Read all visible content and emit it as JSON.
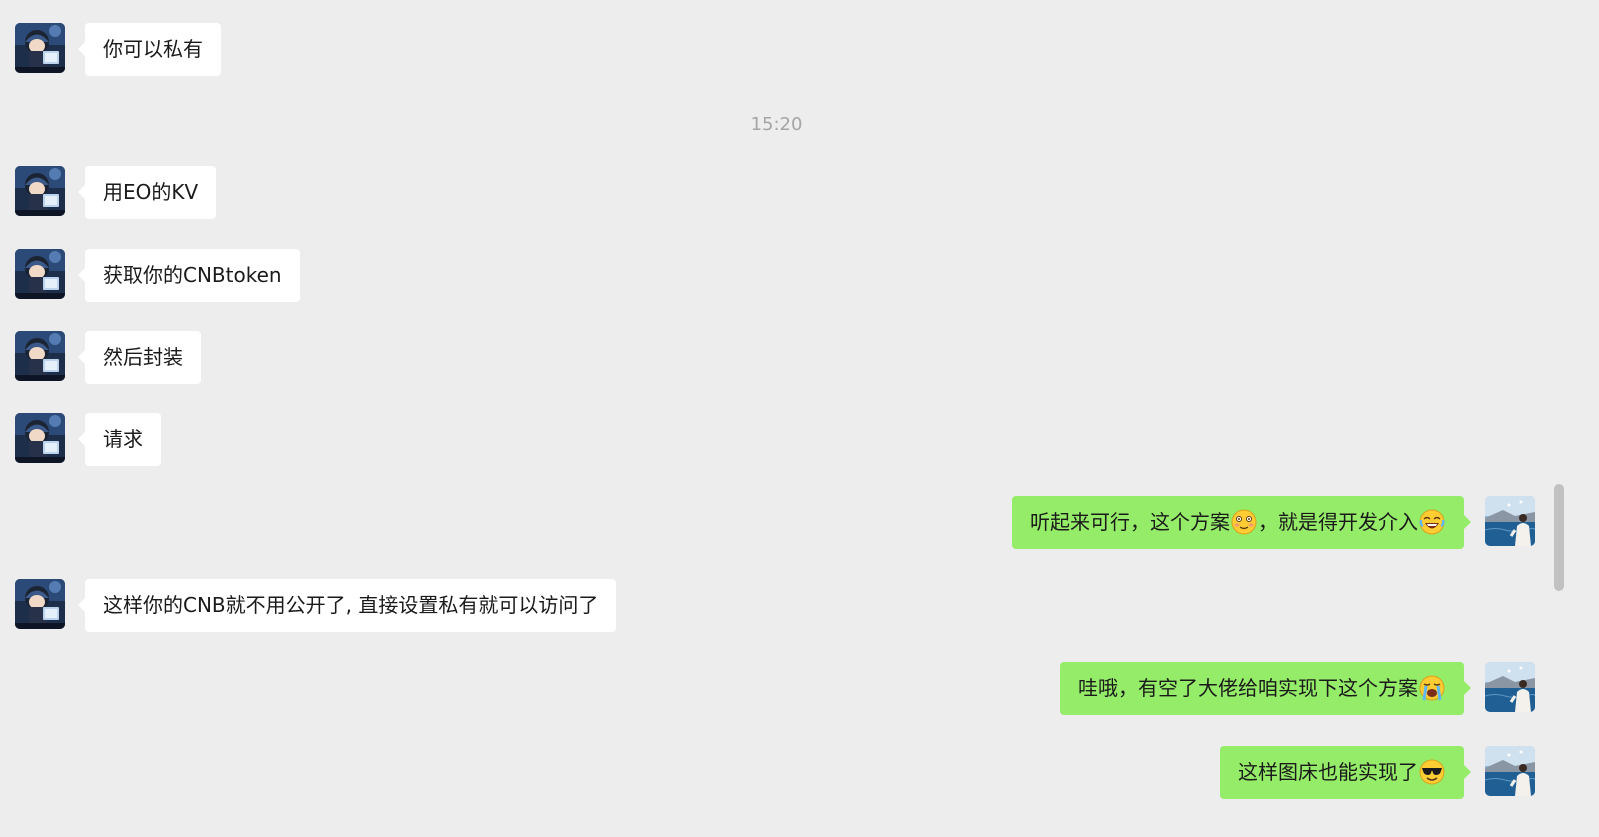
{
  "chat": {
    "timestamp": "15:20",
    "messages": [
      {
        "side": "left",
        "text": "你可以私有"
      },
      {
        "side": "left",
        "text": "用EO的KV"
      },
      {
        "side": "left",
        "text": "获取你的CNBtoken"
      },
      {
        "side": "left",
        "text": "然后封装"
      },
      {
        "side": "left",
        "text": "请求"
      },
      {
        "side": "right",
        "text_a": "听起来可行，这个方案",
        "emoji_a": "flushed-smile-emoji",
        "text_b": "，就是得开发介入",
        "emoji_b": "joy-emoji"
      },
      {
        "side": "left",
        "text": "这样你的CNB就不用公开了, 直接设置私有就可以访问了"
      },
      {
        "side": "right",
        "text_a": "哇哦，有空了大佬给咱实现下这个方案",
        "emoji_a": "loudly-crying-emoji"
      },
      {
        "side": "right",
        "text_a": "这样图床也能实现了",
        "emoji_a": "sunglasses-emoji"
      }
    ]
  },
  "colors": {
    "background": "#ededed",
    "incoming_bubble": "#ffffff",
    "outgoing_bubble": "#95ec69",
    "timestamp_text": "#a5a5a5"
  }
}
